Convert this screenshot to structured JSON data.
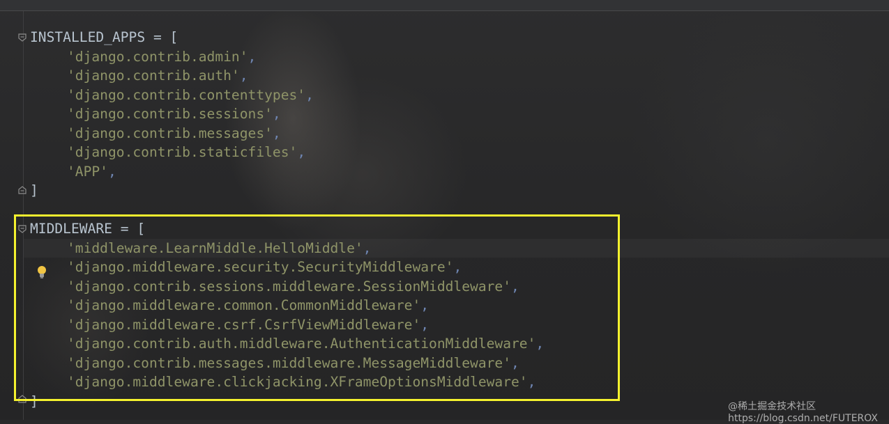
{
  "editor": {
    "installed_apps": {
      "open": "INSTALLED_APPS = [",
      "items": [
        "'django.contrib.admin'",
        "'django.contrib.auth'",
        "'django.contrib.contenttypes'",
        "'django.contrib.sessions'",
        "'django.contrib.messages'",
        "'django.contrib.staticfiles'",
        "'APP'"
      ],
      "close": "]"
    },
    "middleware": {
      "open": "MIDDLEWARE = [",
      "items": [
        "'middleware.LearnMiddle.HelloMiddle'",
        "'django.middleware.security.SecurityMiddleware'",
        "'django.contrib.sessions.middleware.SessionMiddleware'",
        "'django.middleware.common.CommonMiddleware'",
        "'django.middleware.csrf.CsrfViewMiddleware'",
        "'django.contrib.auth.middleware.AuthenticationMiddleware'",
        "'django.contrib.messages.middleware.MessageMiddleware'",
        "'django.middleware.clickjacking.XFrameOptionsMiddleware'"
      ],
      "close": "]"
    },
    "comma": ","
  },
  "colors": {
    "highlight_box": "#f5f22e",
    "string": "#8f9468",
    "comma": "#6f86b3"
  },
  "icons": {
    "fold": "fold-marker-icon",
    "intention": "lightbulb-icon"
  },
  "watermark": {
    "top_line": "@稀土掘金技术社区",
    "bottom_line": "https://blog.csdn.net/FUTEROX"
  }
}
